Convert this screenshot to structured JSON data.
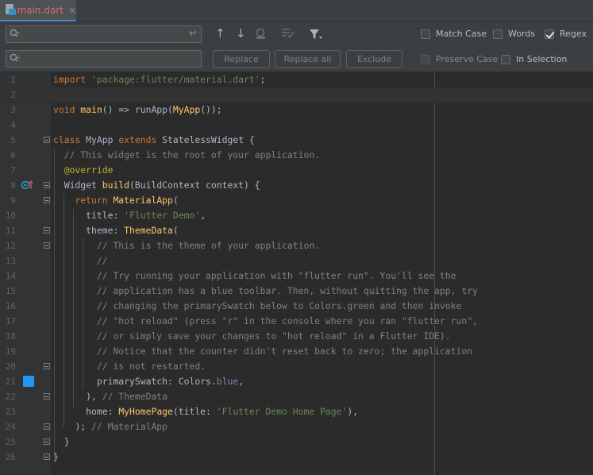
{
  "tab": {
    "filename": "main.dart",
    "close": "×",
    "icon": "dart-file-icon"
  },
  "find": {
    "search_placeholder": "",
    "replace_placeholder": "",
    "buttons": {
      "replace": "Replace",
      "replace_all": "Replace all",
      "exclude": "Exclude"
    },
    "options": {
      "match_case": {
        "label": "Match Case",
        "checked": false
      },
      "words": {
        "label": "Words",
        "checked": false
      },
      "regex": {
        "label": "Regex",
        "checked": true
      },
      "preserve_case": {
        "label": "Preserve Case",
        "checked": false
      },
      "in_selection": {
        "label": "In Selection",
        "checked": false
      }
    }
  },
  "editor": {
    "current_line": 2,
    "color_swatch": "#2196f3",
    "lines": [
      {
        "n": "1"
      },
      {
        "n": "2"
      },
      {
        "n": "3"
      },
      {
        "n": "4"
      },
      {
        "n": "5"
      },
      {
        "n": "6"
      },
      {
        "n": "7"
      },
      {
        "n": "8"
      },
      {
        "n": "9"
      },
      {
        "n": "10"
      },
      {
        "n": "11"
      },
      {
        "n": "12"
      },
      {
        "n": "13"
      },
      {
        "n": "14"
      },
      {
        "n": "15"
      },
      {
        "n": "16"
      },
      {
        "n": "17"
      },
      {
        "n": "18"
      },
      {
        "n": "19"
      },
      {
        "n": "20"
      },
      {
        "n": "21"
      },
      {
        "n": "22"
      },
      {
        "n": "23"
      },
      {
        "n": "24"
      },
      {
        "n": "25"
      },
      {
        "n": "26"
      }
    ],
    "code": {
      "l1_kw": "import",
      "l1_str": "'package:flutter/material.dart'",
      "l1_end": ";",
      "l3_kw": "void",
      "l3_fn": "main",
      "l3_mid": "() => runApp(",
      "l3_fn2": "MyApp",
      "l3_end": "());",
      "l5_kw": "class",
      "l5_name": " MyApp ",
      "l5_kw2": "extends",
      "l5_end": " StatelessWidget {",
      "l6_cm": "// This widget is the root of your application.",
      "l7_an": "@override",
      "l8_a": "Widget ",
      "l8_fn": "build",
      "l8_end": "(BuildContext context) {",
      "l9_kw": "return",
      "l9_fn": "MaterialApp",
      "l9_end": "(",
      "l10_a": "title: ",
      "l10_str": "'Flutter Demo'",
      "l10_end": ",",
      "l11_a": "theme: ",
      "l11_fn": "ThemeData",
      "l11_end": "(",
      "l12_cm": "// This is the theme of your application.",
      "l13_cm": "//",
      "l14_cm": "// Try running your application with \"flutter run\". You'll see the",
      "l15_cm": "// application has a blue toolbar. Then, without quitting the app, try",
      "l16_cm": "// changing the primarySwatch below to Colors.green and then invoke",
      "l17_cm": "// \"hot reload\" (press \"r\" in the console where you ran \"flutter run\",",
      "l18_cm": "// or simply save your changes to \"hot reload\" in a Flutter IDE).",
      "l19_cm": "// Notice that the counter didn't reset back to zero; the application",
      "l20_cm": "// is not restarted.",
      "l21_a": "primarySwatch: Colors.",
      "l21_pr": "blue",
      "l21_end": ",",
      "l22_a": "), ",
      "l22_cm": "// ThemeData",
      "l23_a": "home: ",
      "l23_fn": "MyHomePage",
      "l23_b": "(title: ",
      "l23_str": "'Flutter Demo Home Page'",
      "l23_end": "),",
      "l24_a": "); ",
      "l24_cm": "// MaterialApp",
      "l25_a": "}",
      "l26_a": "}"
    }
  }
}
